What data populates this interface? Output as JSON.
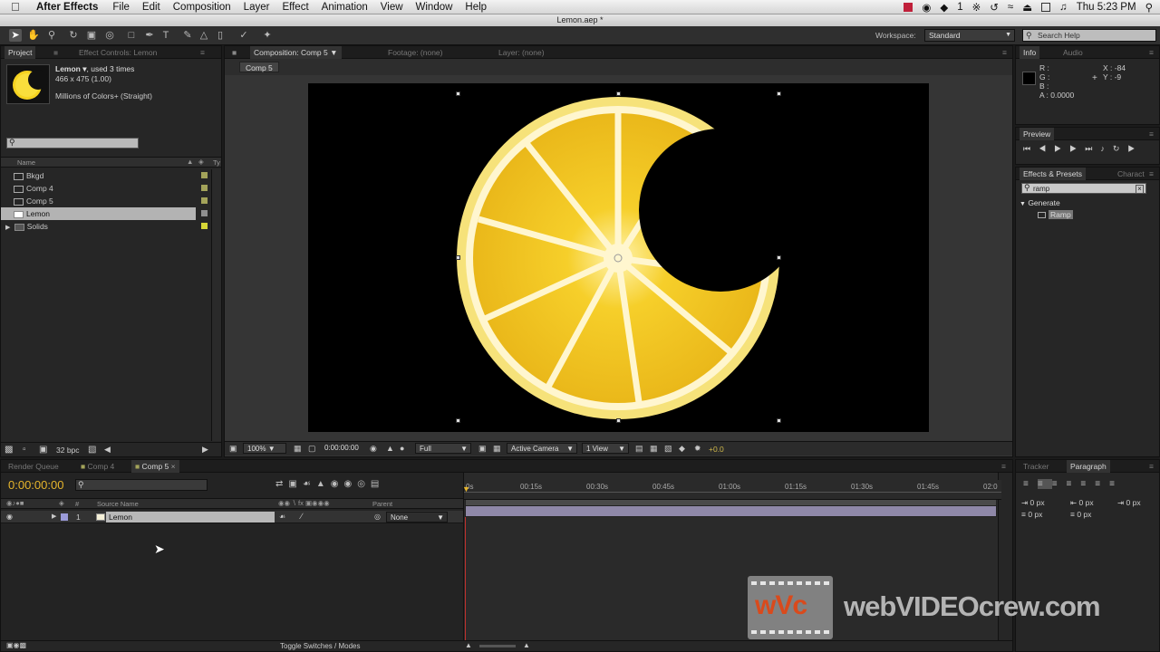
{
  "menubar": {
    "app_name": "After Effects",
    "items": [
      "File",
      "Edit",
      "Composition",
      "Layer",
      "Effect",
      "Animation",
      "View",
      "Window",
      "Help"
    ],
    "clock": "Thu 5:23 PM",
    "status_count": "1"
  },
  "window_title": "Lemon.aep *",
  "toolbar": {
    "workspace_label": "Workspace:",
    "workspace_value": "Standard",
    "search_help_placeholder": "Search Help"
  },
  "project_panel": {
    "tab": "Project",
    "effect_controls_tab": "Effect Controls: Lemon",
    "selected_name": "Lemon ▾",
    "selected_usage": ", used 3 times",
    "selected_dims": "466 x 475 (1.00)",
    "selected_color": "Millions of Colors+ (Straight)",
    "column_name": "Name",
    "column_type": "Ty",
    "items": [
      {
        "name": "Bkgd",
        "label_color": "#a3a35a"
      },
      {
        "name": "Comp 4",
        "label_color": "#a3a35a"
      },
      {
        "name": "Comp 5",
        "label_color": "#a3a35a"
      },
      {
        "name": "Lemon",
        "label_color": "#8f8f8f"
      },
      {
        "name": "Solids",
        "label_color": "#d6d637"
      }
    ],
    "bpc": "32 bpc"
  },
  "composition_panel": {
    "tab": "Composition: Comp 5",
    "footage_tab": "Footage: (none)",
    "layer_tab": "Layer: (none)",
    "sub_tab": "Comp 5",
    "zoom": "100%",
    "timecode": "0:00:00:00",
    "resolution": "Full",
    "camera": "Active Camera",
    "views": "1 View",
    "exposure": "+0.0"
  },
  "info_panel": {
    "tab": "Info",
    "audio_tab": "Audio",
    "r_label": "R :",
    "g_label": "G :",
    "b_label": "B :",
    "a_label": "A : 0.0000",
    "x_value": "X : -84",
    "y_value": "Y : -9"
  },
  "preview_panel": {
    "tab": "Preview"
  },
  "effects_panel": {
    "tab": "Effects & Presets",
    "character_tab": "Charact",
    "search_value": "ramp",
    "category": "Generate",
    "effect": "Ramp"
  },
  "timeline": {
    "tabs": [
      "Render Queue",
      "Comp 4",
      "Comp 5"
    ],
    "timecode": "0:00:00:00",
    "col_source": "Source Name",
    "col_parent": "Parent",
    "col_hash": "#",
    "layer_index": "1",
    "layer_name": "Lemon",
    "parent_value": "None",
    "ticks": [
      "0s",
      "00:15s",
      "00:30s",
      "00:45s",
      "01:00s",
      "01:15s",
      "01:30s",
      "01:45s",
      "02:0"
    ],
    "toggle_label": "Toggle Switches / Modes"
  },
  "right_bottom": {
    "tracker_tab": "Tracker",
    "paragraph_tab": "Paragraph",
    "px_values": [
      "0 px",
      "0 px",
      "0 px",
      "0 px",
      "0 px"
    ]
  },
  "watermark": {
    "logo_text": "wVc",
    "brand_text": "webVIDEOcrew.com"
  }
}
